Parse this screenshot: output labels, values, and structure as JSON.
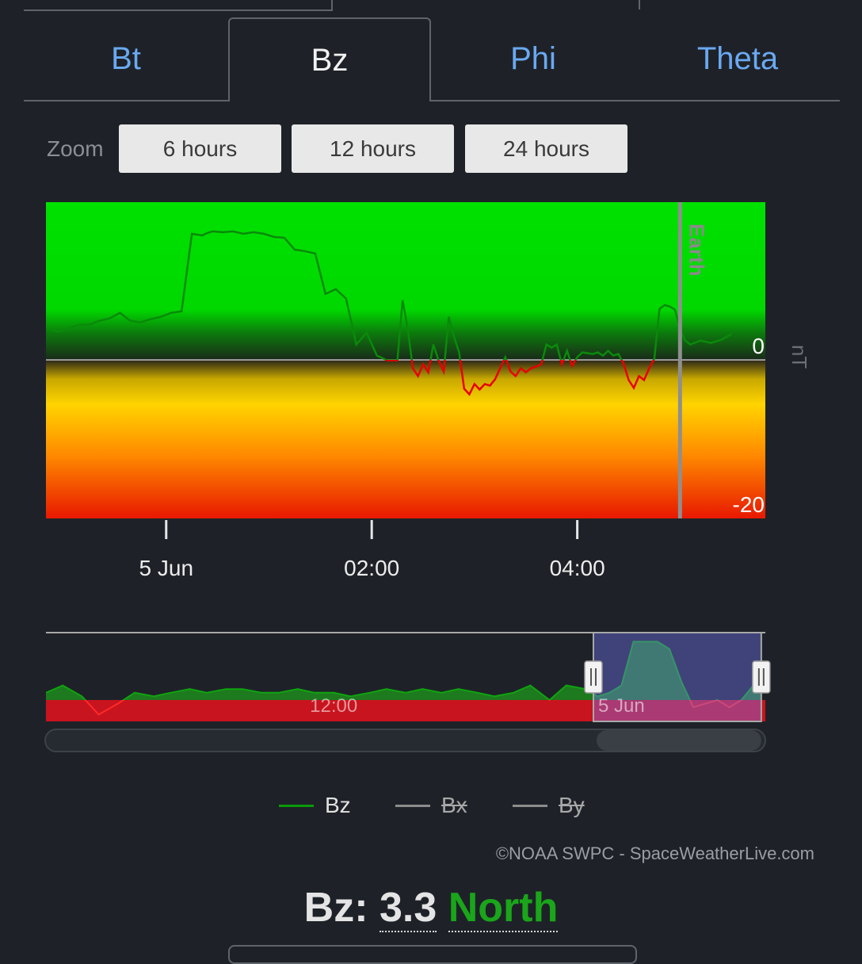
{
  "tabs": [
    {
      "label": "Bt",
      "active": false
    },
    {
      "label": "Bz",
      "active": true
    },
    {
      "label": "Phi",
      "active": false
    },
    {
      "label": "Theta",
      "active": false
    }
  ],
  "zoom": {
    "label": "Zoom",
    "options": [
      "6 hours",
      "12 hours",
      "24 hours"
    ]
  },
  "chart_data": [
    {
      "type": "line",
      "ylabel": "nT",
      "ylim": [
        -20,
        20
      ],
      "ytick_labels": [
        "0",
        "-20"
      ],
      "xtick_labels": [
        "5 Jun",
        "02:00",
        "04:00"
      ],
      "xtick_hours": [
        0,
        2,
        4
      ],
      "xlim_hours": [
        -1.17,
        5.83
      ],
      "marker": {
        "label": "Earth",
        "hour": 5.0
      },
      "background": "green above 0 nT, yellow-orange-red gradient below 0 nT",
      "series": [
        {
          "name": "Bz",
          "x_hours": [
            -1.17,
            -1.05,
            -0.95,
            -0.85,
            -0.75,
            -0.65,
            -0.55,
            -0.45,
            -0.35,
            -0.25,
            -0.15,
            -0.05,
            0.05,
            0.15,
            0.25,
            0.35,
            0.4,
            0.45,
            0.55,
            0.65,
            0.75,
            0.85,
            0.95,
            1.05,
            1.15,
            1.25,
            1.35,
            1.45,
            1.55,
            1.65,
            1.75,
            1.85,
            1.95,
            2.05,
            2.15,
            2.25,
            2.3,
            2.35,
            2.4,
            2.45,
            2.5,
            2.55,
            2.6,
            2.65,
            2.7,
            2.75,
            2.8,
            2.85,
            2.9,
            2.95,
            3.0,
            3.05,
            3.1,
            3.15,
            3.2,
            3.25,
            3.3,
            3.35,
            3.4,
            3.45,
            3.5,
            3.55,
            3.6,
            3.65,
            3.7,
            3.75,
            3.8,
            3.85,
            3.9,
            3.95,
            4.0,
            4.05,
            4.1,
            4.15,
            4.2,
            4.25,
            4.3,
            4.35,
            4.4,
            4.45,
            4.5,
            4.55,
            4.6,
            4.65,
            4.7,
            4.75,
            4.8,
            4.85,
            4.9,
            4.95,
            5.0,
            5.05,
            5.1,
            5.2,
            5.3,
            5.4,
            5.5,
            5.6,
            5.7,
            5.75,
            5.83
          ],
          "values": [
            4,
            3.6,
            4,
            4.5,
            4.5,
            5,
            5.3,
            6,
            5,
            4.8,
            5.2,
            5.5,
            6,
            6.2,
            16,
            15.8,
            16.1,
            16.3,
            16.2,
            16.3,
            16,
            16.2,
            16,
            15.6,
            15.5,
            14,
            13.8,
            13.5,
            8.4,
            9,
            7.8,
            2,
            3.5,
            0.6,
            0,
            0,
            7.6,
            4,
            -1,
            -2,
            -0.5,
            -1.5,
            2,
            0,
            -1.4,
            5.5,
            3,
            1,
            -3.6,
            -4.3,
            -3,
            -3.7,
            -3,
            -3.2,
            -2.4,
            -1,
            0.4,
            -1.4,
            -2,
            -1,
            -1.5,
            -1,
            -0.8,
            -0.5,
            2,
            1.6,
            2,
            -0.5,
            1.2,
            -0.7,
            0.4,
            1,
            0.9,
            0.8,
            1,
            0.6,
            1.2,
            0.6,
            0.8,
            -0.4,
            -2.5,
            -3.5,
            -2,
            -2.5,
            -1,
            0.2,
            6.5,
            7,
            6.8,
            6.4,
            4,
            2.5,
            2,
            2.5,
            2.2,
            2.6,
            3.3
          ]
        },
        {
          "name": "Bx",
          "hidden": true,
          "values": []
        },
        {
          "name": "By",
          "hidden": true,
          "values": []
        }
      ]
    },
    {
      "type": "area",
      "role": "navigator",
      "xtick_labels": [
        "12:00",
        "5 Jun"
      ],
      "xtick_hours": [
        -12,
        0
      ],
      "xlim_hours": [
        -24,
        6
      ],
      "selected_range_hours": [
        -1.17,
        5.83
      ],
      "series": [
        {
          "name": "Bz",
          "x_hours": [
            -24,
            -23.3,
            -22.5,
            -21.8,
            -21,
            -20.3,
            -19.5,
            -18.8,
            -18,
            -17.3,
            -16.5,
            -15.8,
            -15,
            -14.3,
            -13.5,
            -12.8,
            -12,
            -11.3,
            -10.5,
            -9.8,
            -9,
            -8.3,
            -7.5,
            -6.8,
            -6,
            -5.3,
            -4.5,
            -3.8,
            -3,
            -2.3,
            -1.5,
            -1,
            -0.5,
            0,
            0.5,
            1,
            1.5,
            2,
            2.5,
            3,
            3.5,
            4,
            4.5,
            5,
            5.5,
            5.83
          ],
          "values": [
            2,
            4,
            1,
            -4,
            -1,
            2,
            1,
            2,
            3,
            2,
            3,
            3,
            2,
            2,
            3,
            2,
            2,
            1,
            2,
            3,
            2,
            3,
            2,
            3,
            2,
            1,
            2,
            4,
            0,
            4,
            3,
            1,
            2,
            4,
            16,
            16,
            16,
            14,
            5,
            -2,
            -1,
            0,
            -2,
            0,
            4,
            2
          ]
        }
      ]
    }
  ],
  "legend": [
    {
      "label": "Bz",
      "color": "#0a9a0a",
      "enabled": true
    },
    {
      "label": "Bx",
      "color": "#8c8c8c",
      "enabled": false
    },
    {
      "label": "By",
      "color": "#8c8c8c",
      "enabled": false
    }
  ],
  "credit": "©NOAA SWPC - SpaceWeatherLive.com",
  "readout": {
    "label": "Bz:",
    "value": "3.3",
    "direction": "North"
  },
  "colors": {
    "background": "#1e2228",
    "tab_inactive": "#6aa9f2",
    "north": "#1aa51a",
    "south": "#e80000"
  }
}
